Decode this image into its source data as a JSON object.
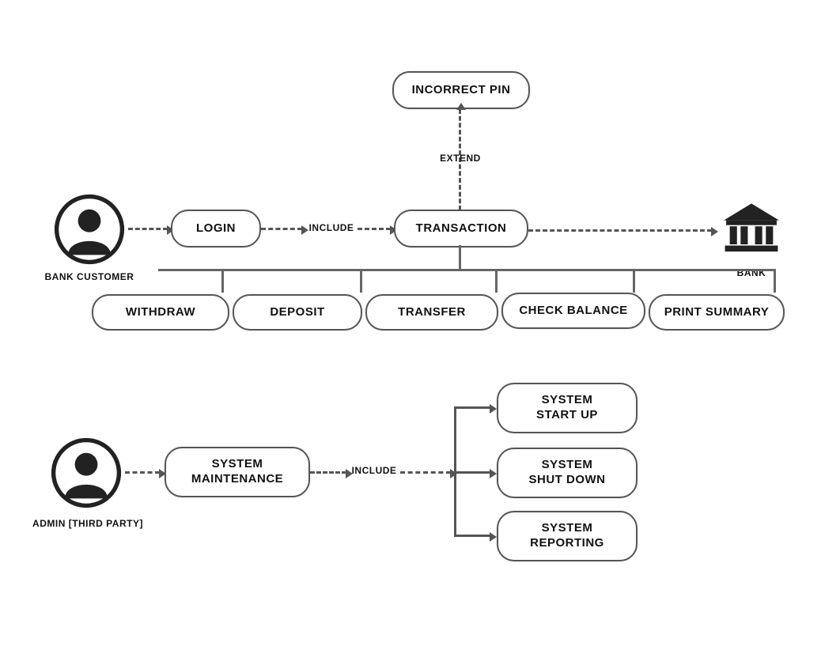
{
  "actors": {
    "customer": "BANK CUSTOMER",
    "admin": "ADMIN [THIRD PARTY]",
    "bank": "BANK"
  },
  "relations": {
    "extend": "EXTEND",
    "include1": "INCLUDE",
    "include2": "INCLUDE"
  },
  "usecases": {
    "incorrect_pin": "INCORRECT PIN",
    "login": "LOGIN",
    "transaction": "TRANSACTION",
    "withdraw": "WITHDRAW",
    "deposit": "DEPOSIT",
    "transfer": "TRANSFER",
    "check_balance": "CHECK BALANCE",
    "print_summary": "PRINT SUMMARY",
    "system_maintenance": "SYSTEM\nMAINTENANCE",
    "system_startup": "SYSTEM\nSTART UP",
    "system_shutdown": "SYSTEM\nSHUT DOWN",
    "system_reporting": "SYSTEM\nREPORTING"
  }
}
